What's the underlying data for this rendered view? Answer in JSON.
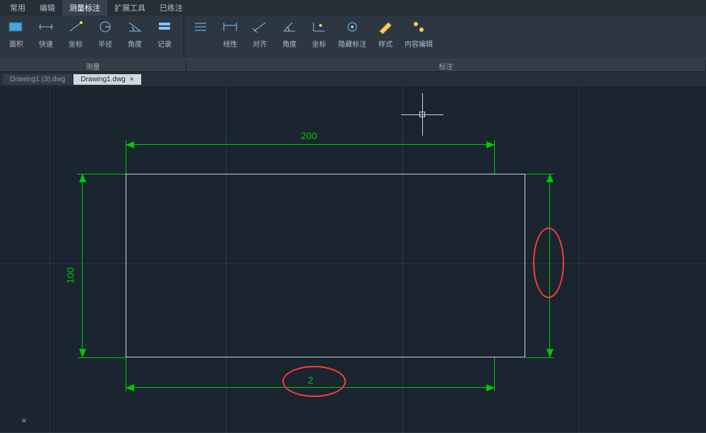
{
  "menu_tabs": {
    "items": [
      "常用",
      "编辑",
      "测量标注",
      "扩展工具",
      "已练注"
    ],
    "active_index": 2
  },
  "ribbon": {
    "group_labels": [
      "测量",
      "标注"
    ],
    "measure_items": [
      {
        "label": "面积",
        "icon": "area-icon"
      },
      {
        "label": "快速",
        "icon": "quick-icon"
      },
      {
        "label": "坐标",
        "icon": "coord-icon"
      },
      {
        "label": "半径",
        "icon": "radius-icon"
      },
      {
        "label": "角度",
        "icon": "angle-icon"
      },
      {
        "label": "记录",
        "icon": "record-icon"
      }
    ],
    "annotate_items": [
      {
        "label": "",
        "icon": "list-icon"
      },
      {
        "label": "线性",
        "icon": "linear-icon"
      },
      {
        "label": "对齐",
        "icon": "aligned-icon"
      },
      {
        "label": "角度",
        "icon": "angle2-icon"
      },
      {
        "label": "坐标",
        "icon": "coord2-icon"
      },
      {
        "label": "隐藏标注",
        "icon": "hide-icon"
      },
      {
        "label": "样式",
        "icon": "style-icon"
      },
      {
        "label": "内容编辑",
        "icon": "edit-icon"
      }
    ]
  },
  "doc_tabs": {
    "items": [
      "Drawing1 (3).dwg",
      "Drawing1.dwg"
    ],
    "active_index": 1
  },
  "drawing": {
    "dim_top": "200",
    "dim_left": "100",
    "dim_bottom": "2"
  },
  "bottom_close": "×"
}
